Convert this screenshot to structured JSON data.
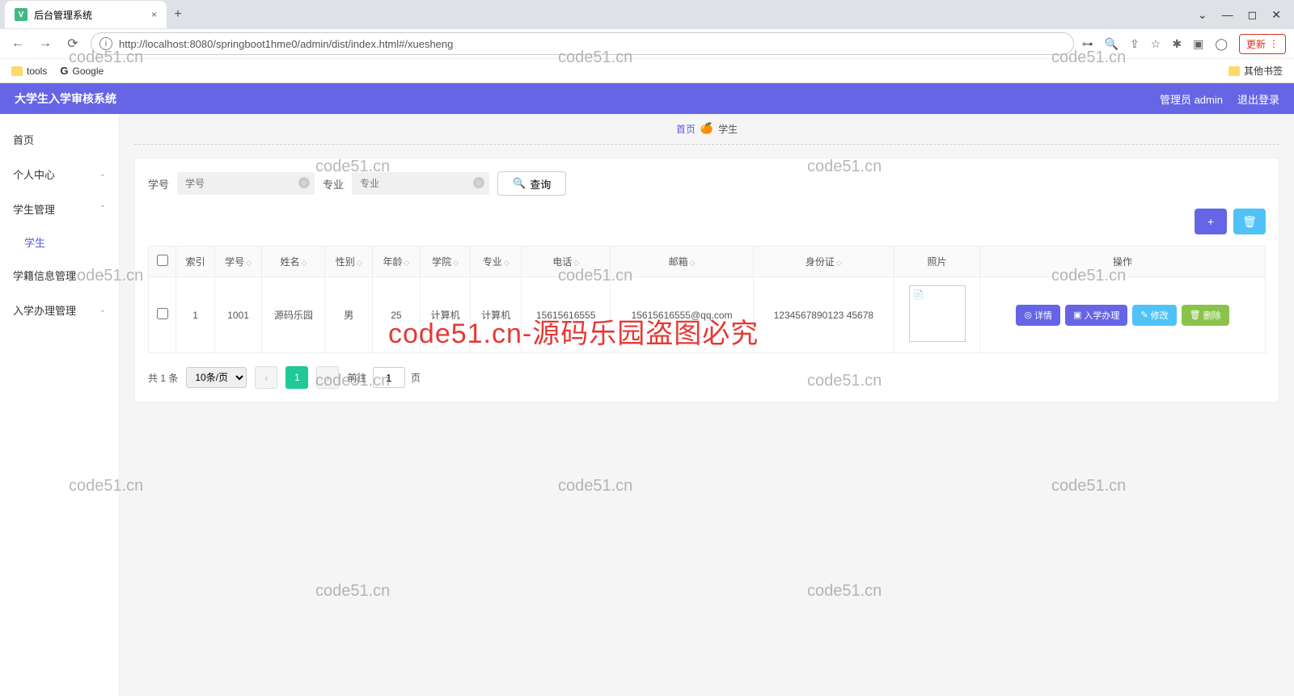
{
  "browser": {
    "tab_title": "后台管理系统",
    "url_display": "http://localhost:8080/springboot1hme0/admin/dist/index.html#/xuesheng",
    "url_host": "localhost",
    "update_label": "更新",
    "bookmarks": {
      "tools": "tools",
      "google": "Google",
      "other": "其他书签"
    }
  },
  "header": {
    "title": "大学生入学审核系统",
    "user_label": "管理员 admin",
    "logout": "退出登录"
  },
  "sidebar": {
    "items": [
      {
        "label": "首页",
        "expandable": false
      },
      {
        "label": "个人中心",
        "expandable": true
      },
      {
        "label": "学生管理",
        "expandable": true,
        "expanded": true,
        "children": [
          {
            "label": "学生"
          }
        ]
      },
      {
        "label": "学籍信息管理",
        "expandable": true
      },
      {
        "label": "入学办理管理",
        "expandable": true
      }
    ]
  },
  "breadcrumb": {
    "home": "首页",
    "current": "学生"
  },
  "search": {
    "field1_label": "学号",
    "field1_placeholder": "学号",
    "field2_label": "专业",
    "field2_placeholder": "专业",
    "query_btn": "查询"
  },
  "table": {
    "cols": [
      "索引",
      "学号",
      "姓名",
      "性别",
      "年龄",
      "学院",
      "专业",
      "电话",
      "邮箱",
      "身份证",
      "照片",
      "操作"
    ],
    "rows": [
      {
        "idx": "1",
        "sno": "1001",
        "name": "源码乐园",
        "gender": "男",
        "age": "25",
        "college": "计算机",
        "major": "计算机",
        "phone": "15615616555",
        "email": "15615616555@qq.com",
        "idcard": "1234567890123 45678"
      }
    ],
    "ops": {
      "detail": "详情",
      "enroll": "入学办理",
      "edit": "修改",
      "delete": "删除"
    }
  },
  "pager": {
    "total_text": "共 1 条",
    "page_size": "10条/页",
    "current": "1",
    "jump_prefix": "前往",
    "jump_val": "1",
    "jump_suffix": "页"
  },
  "watermark": {
    "text": "code51.cn",
    "red": "code51.cn-源码乐园盗图必究"
  }
}
